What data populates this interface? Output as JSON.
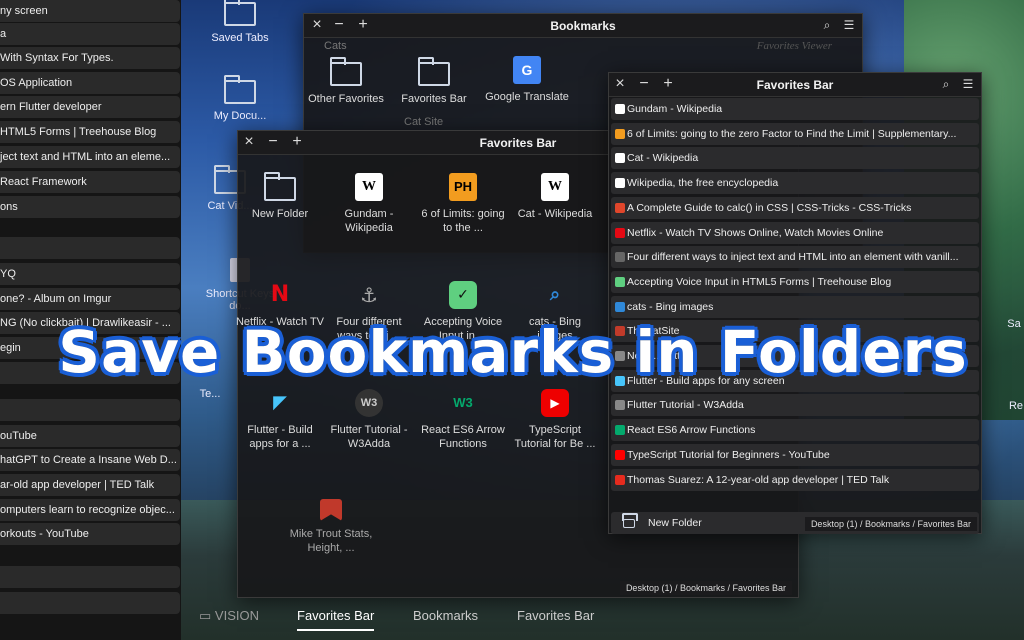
{
  "sidebar": {
    "items": [
      {
        "label": "ny screen"
      },
      {
        "label": "a"
      },
      {
        "label": "With Syntax For Types."
      },
      {
        "label": "OS Application"
      },
      {
        "label": "ern Flutter developer"
      },
      {
        "label": "HTML5 Forms | Treehouse Blog"
      },
      {
        "label": "ject text and HTML into an eleme..."
      },
      {
        "label": "React Framework"
      },
      {
        "label": "ons"
      },
      {
        "label": ""
      },
      {
        "label": "YQ"
      },
      {
        "label": "one? - Album on Imgur"
      },
      {
        "label": "NG (No clickbait) | Drawlikeasir - ..."
      },
      {
        "label": "egin"
      },
      {
        "label": ""
      },
      {
        "label": ""
      },
      {
        "label": "ouTube"
      },
      {
        "label": "hatGPT to Create a Insane Web D..."
      },
      {
        "label": "ar-old app developer | TED Talk"
      },
      {
        "label": "omputers learn to recognize objec..."
      },
      {
        "label": "orkouts - YouTube"
      },
      {
        "label": ""
      },
      {
        "label": ""
      }
    ]
  },
  "desktop": {
    "icons": [
      {
        "label": "Saved Tabs"
      },
      {
        "label": "My Docu..."
      },
      {
        "label": "Cat Vid..."
      },
      {
        "label": "Shortcut Keys do..."
      },
      {
        "label": "Te..."
      },
      {
        "label": "Sa"
      },
      {
        "label": "Re"
      }
    ]
  },
  "bookmarks_window": {
    "title": "Bookmarks",
    "items": [
      {
        "label": "Other Favorites",
        "icon": "folder-icon"
      },
      {
        "label": "Favorites Bar",
        "icon": "folder-icon"
      },
      {
        "label": "Google Translate",
        "icon": "google-translate-icon"
      }
    ],
    "behind_labels": [
      "Cats",
      "Cat Site"
    ],
    "bg_text": "Favorites Viewer",
    "path": "Desktop (1) / Bookmarks / Favorites Bar"
  },
  "grid_window": {
    "title": "Favorites Bar",
    "items": [
      {
        "label": "New Folder",
        "icon": "folder-icon",
        "glyph": ""
      },
      {
        "label": "Gundam - Wikipedia",
        "icon": "wikipedia-icon",
        "glyph": "W"
      },
      {
        "label": "6 of Limits: going to the ...",
        "icon": "ph-icon",
        "glyph": "PH"
      },
      {
        "label": "Cat - Wikipedia",
        "icon": "wikipedia-icon",
        "glyph": "W"
      },
      {
        "label": "Netflix - Watch TV",
        "icon": "netflix-icon",
        "glyph": "N"
      },
      {
        "label": "Four different ways to inj ...",
        "icon": "anchor-icon",
        "glyph": "⚓"
      },
      {
        "label": "Accepting Voice Input in ...",
        "icon": "treehouse-icon",
        "glyph": "✓"
      },
      {
        "label": "cats - Bing images",
        "icon": "search-icon",
        "glyph": "🔍"
      },
      {
        "label": "Flutter - Build apps for a ...",
        "icon": "flutter-icon",
        "glyph": "◤"
      },
      {
        "label": "Flutter Tutorial - W3Adda",
        "icon": "w3adda-icon",
        "glyph": "W3"
      },
      {
        "label": "React ES6 Arrow Functions",
        "icon": "w3schools-icon",
        "glyph": "W3"
      },
      {
        "label": "TypeScript Tutorial for Be ...",
        "icon": "youtube-icon",
        "glyph": "▶"
      },
      {
        "label": "Mike Trout Stats, Height, ...",
        "icon": "bookmark-icon",
        "glyph": ""
      }
    ],
    "path": "Desktop (1) / Bookmarks / Favorites Bar"
  },
  "list_window": {
    "title": "Favorites Bar",
    "rows": [
      {
        "label": "Gundam - Wikipedia",
        "color": "#ffffff"
      },
      {
        "label": "6 of Limits: going to the zero Factor to Find the Limit | Supplementary...",
        "color": "#f29c1f"
      },
      {
        "label": "Cat - Wikipedia",
        "color": "#ffffff"
      },
      {
        "label": "Wikipedia, the free encyclopedia",
        "color": "#ffffff"
      },
      {
        "label": "A Complete Guide to calc() in CSS | CSS-Tricks - CSS-Tricks",
        "color": "#e0462b"
      },
      {
        "label": "Netflix - Watch TV Shows Online, Watch Movies Online",
        "color": "#e50914"
      },
      {
        "label": "Four different ways to inject text and HTML into an element with vanill...",
        "color": "#666666"
      },
      {
        "label": "Accepting Voice Input in HTML5 Forms | Treehouse Blog",
        "color": "#5fcf80"
      },
      {
        "label": "cats - Bing images",
        "color": "#2f88d8"
      },
      {
        "label": "TheCatSite",
        "color": "#c23b2a"
      },
      {
        "label": "News... Kitty",
        "color": "#888888"
      },
      {
        "label": "Flutter - Build apps for any screen",
        "color": "#47c5fb"
      },
      {
        "label": "Flutter Tutorial - W3Adda",
        "color": "#888888"
      },
      {
        "label": "React ES6 Arrow Functions",
        "color": "#04aa6d"
      },
      {
        "label": "TypeScript Tutorial for Beginners - YouTube",
        "color": "#ff0000"
      },
      {
        "label": "Thomas Suarez: A 12-year-old app developer | TED Talk",
        "color": "#e62b1e"
      }
    ],
    "new_folder": "New Folder",
    "path": "Desktop (1) / Bookmarks / Favorites Bar"
  },
  "bottom_tabs": [
    {
      "label": "VISION"
    },
    {
      "label": "Favorites Bar"
    },
    {
      "label": "Bookmarks"
    },
    {
      "label": "Favorites Bar"
    }
  ],
  "overlay": {
    "text": "Save Bookmarks in Folders"
  },
  "colors": {
    "accent": "#1a5fd6",
    "window_bg": "#18181a"
  }
}
